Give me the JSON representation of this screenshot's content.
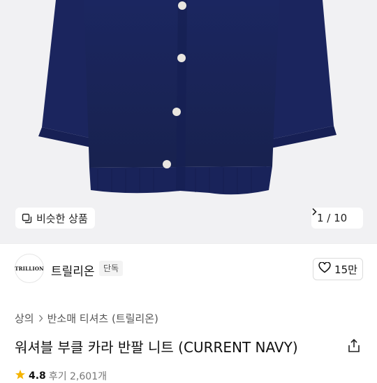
{
  "hero": {
    "similar_button_label": "비슷한 상품",
    "counter_text": "1 / 10"
  },
  "brand": {
    "logo_text": "TRILLION",
    "name": "트릴리온",
    "exclusive_badge": "단독",
    "likes": "15만"
  },
  "breadcrumb": {
    "category": "상의",
    "subcategory": "반소매 티셔츠 (트릴리온)"
  },
  "product": {
    "title": "워셔블 부클 카라 반팔 니트 (CURRENT NAVY)",
    "rating": "4.8",
    "reviews": "후기 2,601개"
  },
  "colors": {
    "navy": "#1e2a63",
    "background": "#f1f1f3",
    "star": "#f5b400"
  },
  "icons": [
    "similar-items-icon",
    "chevron-right-icon",
    "heart-icon",
    "share-icon",
    "star-icon"
  ]
}
